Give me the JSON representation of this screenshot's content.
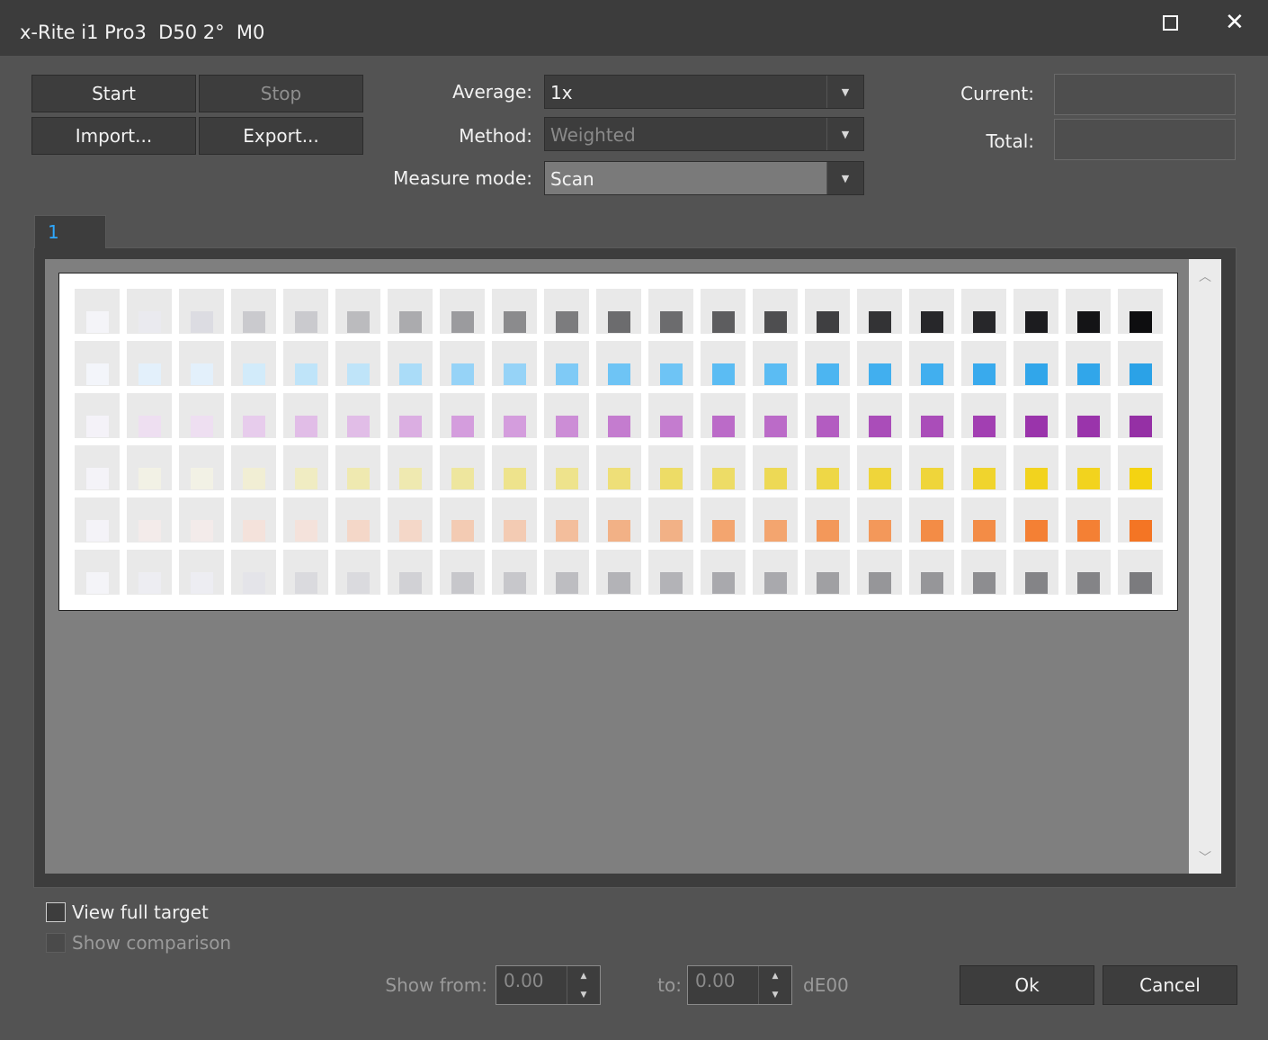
{
  "window": {
    "title": "x-Rite i1 Pro3  D50 2°  M0",
    "maximize_icon": "maximize-icon",
    "close_glyph": "✕"
  },
  "toolbar": {
    "start_label": "Start",
    "stop_label": "Stop",
    "import_label": "Import...",
    "export_label": "Export..."
  },
  "settings": {
    "average_label": "Average:",
    "average_value": "1x",
    "method_label": "Method:",
    "method_value": "Weighted",
    "measure_mode_label": "Measure mode:",
    "measure_mode_value": "Scan"
  },
  "readouts": {
    "current_label": "Current:",
    "total_label": "Total:"
  },
  "tabs": [
    {
      "label": "1"
    }
  ],
  "target": {
    "rows": [
      [
        "#f4f4f8",
        "#eaeaef",
        "#dcdce2",
        "#cacace",
        "#bbbbbe",
        "#ababae",
        "#9b9b9e",
        "#8b8b8d",
        "#7c7c7e",
        "#6c6c6e",
        "#5d5d5f",
        "#4e4e50",
        "#3f3f41",
        "#333335",
        "#27272a",
        "#1c1c1f",
        "#141416",
        "#0e0e10"
      ],
      [
        "#f3f5fa",
        "#e3f0fb",
        "#d2ebfa",
        "#bfe4f9",
        "#aadcf8",
        "#96d3f7",
        "#7fcaf6",
        "#6ec4f5",
        "#5bbcf3",
        "#4cb5f1",
        "#41afef",
        "#39aaed",
        "#31a6ea",
        "#2ba2e7"
      ],
      [
        "#f4f2f8",
        "#eedff1",
        "#e7ccec",
        "#e1bde7",
        "#dbaee2",
        "#d49ddd",
        "#cc8dd6",
        "#c47ccf",
        "#bb6bc8",
        "#b35cc1",
        "#aa4db9",
        "#a23fb2",
        "#9a34ab",
        "#9530a5"
      ],
      [
        "#f4f3f8",
        "#f2f1e5",
        "#f1eed4",
        "#f0ecc2",
        "#efe9b0",
        "#eee69e",
        "#eee38c",
        "#eedf78",
        "#eddc66",
        "#edd955",
        "#eed746",
        "#efd53a",
        "#f0d42d",
        "#f2d31e",
        "#f4d312"
      ],
      [
        "#f4f3f8",
        "#f3ebea",
        "#f4e2db",
        "#f4d7c8",
        "#f3cbb3",
        "#f3be9c",
        "#f2b186",
        "#f3a56f",
        "#f3985a",
        "#f38c46",
        "#f48034",
        "#f47524"
      ],
      [
        "#f4f4f8",
        "#ededf2",
        "#e4e4e9",
        "#dadade",
        "#d1d1d5",
        "#c7c7cb",
        "#bdbdc1",
        "#b3b3b7",
        "#a9a9ad",
        "#a0a0a3",
        "#969699",
        "#8d8d90",
        "#848487",
        "#7b7b7e"
      ]
    ],
    "cols": 21
  },
  "options": {
    "view_full_target_label": "View full target",
    "show_comparison_label": "Show comparison"
  },
  "filter": {
    "show_from_label": "Show from:",
    "from_value": "0.00",
    "to_label": "to:",
    "to_value": "0.00",
    "unit_label": "dE00"
  },
  "dialog": {
    "ok_label": "Ok",
    "cancel_label": "Cancel"
  }
}
